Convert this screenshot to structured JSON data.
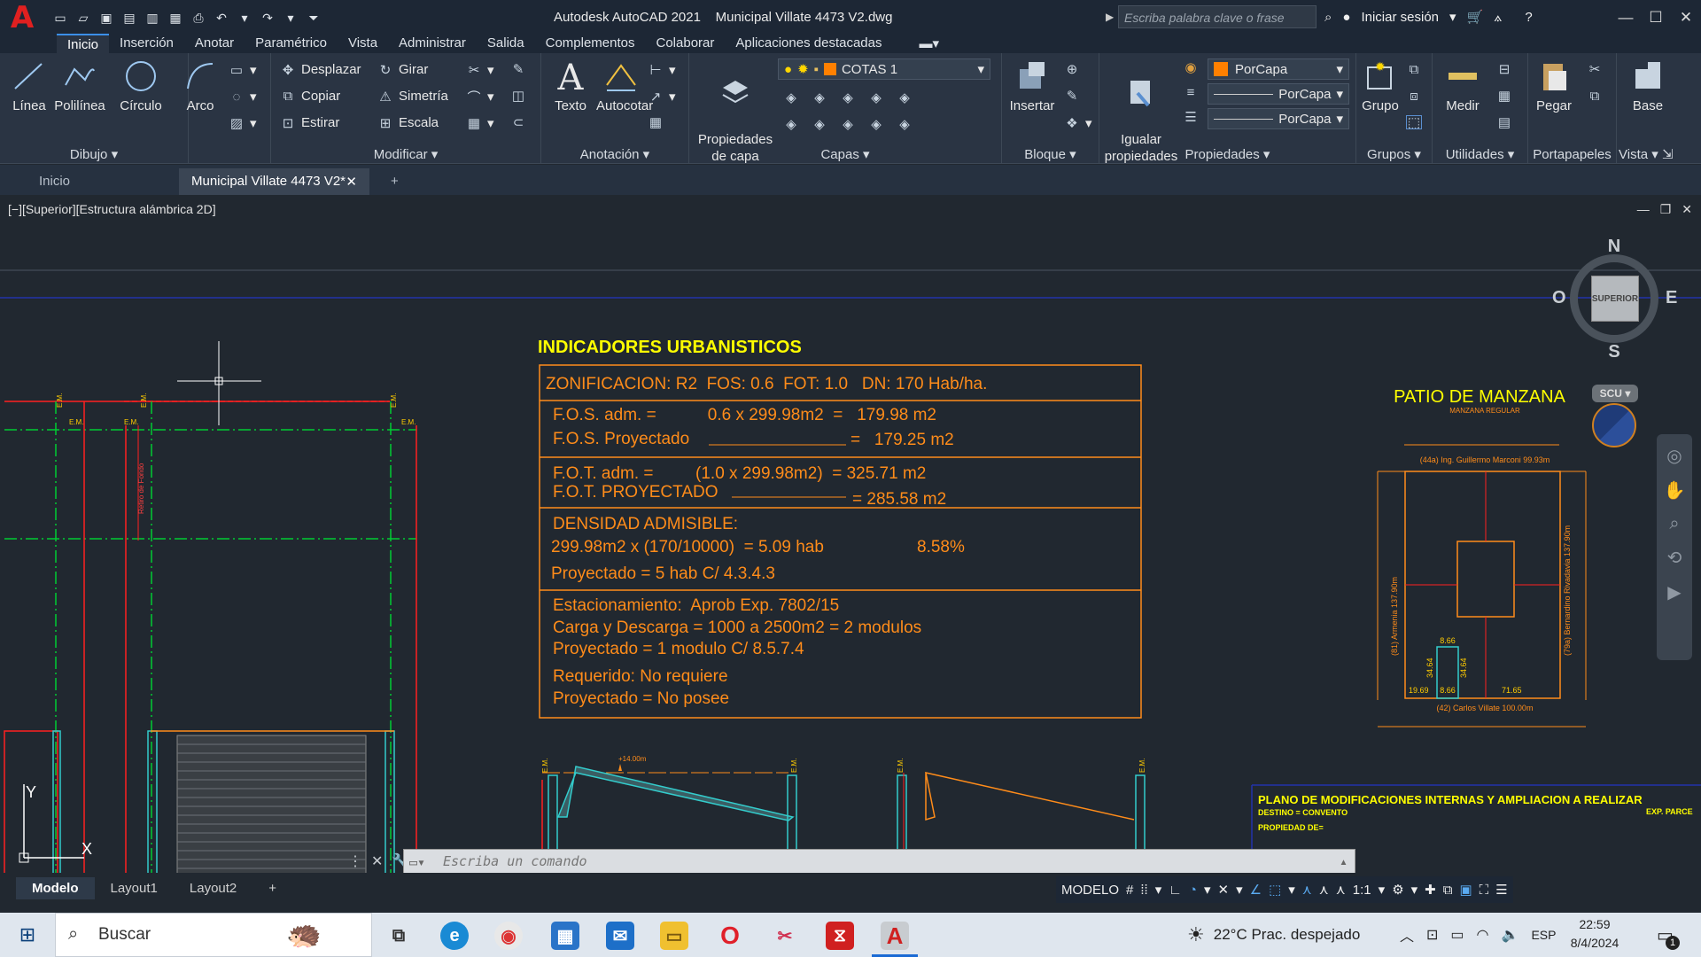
{
  "app": {
    "title": "Autodesk AutoCAD 2021    Municipal Villate 4473 V2.dwg",
    "search_placeholder": "Escriba palabra clave o frase",
    "signin": "Iniciar sesión"
  },
  "ribbon_tabs": [
    "Inicio",
    "Inserción",
    "Anotar",
    "Paramétrico",
    "Vista",
    "Administrar",
    "Salida",
    "Complementos",
    "Colaborar",
    "Aplicaciones destacadas"
  ],
  "ribbon": {
    "dibujo": {
      "title": "Dibujo",
      "linea": "Línea",
      "polilinea": "Polilínea",
      "circulo": "Círculo",
      "arco": "Arco"
    },
    "modificar": {
      "title": "Modificar",
      "desplazar": "Desplazar",
      "girar": "Girar",
      "copiar": "Copiar",
      "simetria": "Simetría",
      "estirar": "Estirar",
      "escala": "Escala"
    },
    "anotacion": {
      "title": "Anotación",
      "texto": "Texto",
      "autocotar": "Autocotar"
    },
    "capas": {
      "title": "Capas",
      "propiedades": "Propiedades\nde capa",
      "layer_value": "COTAS 1"
    },
    "bloque": {
      "title": "Bloque",
      "insertar": "Insertar"
    },
    "propiedades": {
      "title": "Propiedades",
      "igualar": "Igualar\npropiedades",
      "color": "PorCapa",
      "linetype": "PorCapa",
      "lineweight": "PorCapa"
    },
    "grupos": {
      "title": "Grupos",
      "grupo": "Grupo"
    },
    "utilidades": {
      "title": "Utilidades",
      "medir": "Medir"
    },
    "portapapeles": {
      "title": "Portapapeles",
      "pegar": "Pegar"
    },
    "vista": {
      "title": "Vista",
      "base": "Base"
    }
  },
  "doc_tabs": {
    "inicio": "Inicio",
    "active": "Municipal Villate 4473 V2*"
  },
  "viewport_label": "[−][Superior][Estructura alámbrica 2D]",
  "viewcube": {
    "n": "N",
    "s": "S",
    "e": "E",
    "o": "O",
    "face": "SUPERIOR",
    "ucs": "SCU"
  },
  "drawing": {
    "title": "INDICADORES URBANISTICOS",
    "row1": "ZONIFICACION: R2  FOS: 0.6  FOT: 1.0   DN: 170 Hab/ha.",
    "fos_adm": "F.O.S. adm. =           0.6 x 299.98m2  =   179.98 m2",
    "fos_proy": "F.O.S. Proyectado",
    "fos_proy_val": "=   179.25 m2",
    "fot_adm": "F.O.T. adm. =         (1.0 x 299.98m2)  = 325.71 m2",
    "fot_proy": "F.O.T. PROYECTADO",
    "fot_proy_val": "= 285.58 m2",
    "dens_title": "DENSIDAD ADMISIBLE:",
    "dens_calc": "299.98m2 x (170/10000)  = 5.09 hab",
    "dens_pct": "8.58%",
    "dens_proy": "Proyectado = 5 hab C/ 4.3.4.3",
    "est1": "Estacionamiento:  Aprob Exp. 7802/15",
    "est2": "Carga y Descarga = 1000 a 2500m2 = 2 modulos",
    "est3": "Proyectado = 1 modulo C/ 8.5.7.4",
    "est4": "Requerido: No requiere",
    "est5": "Proyectado = No posee",
    "patio_title": "PATIO DE MANZANA",
    "patio_sub": "MANZANA REGULAR",
    "patio_top": "(44a) Ing. Guillermo Marconi  99.93m",
    "patio_bottom": "(42) Carlos Villate 100.00m",
    "patio_left": "(81) Armenia 137.90m",
    "patio_right": "(79a) Bernardino Rivadavia 137.90m",
    "dim_866a": "8.66",
    "dim_866b": "8.66",
    "dim_3464a": "34.64",
    "dim_3464b": "34.64",
    "dim_1969": "19.69",
    "dim_7165": "71.65",
    "em": "E.M.",
    "retiro": "Retiro de Fondo",
    "level": "+14.00m",
    "plano_title": "PLANO DE MODIFICACIONES INTERNAS Y AMPLIACION A REALIZAR",
    "plano_destino": "DESTINO = CONVENTO",
    "plano_prop": "PROPIEDAD DE=",
    "plano_exp": "EXP. PARCE"
  },
  "command_placeholder": "Escriba un comando",
  "layout_tabs": [
    "Modelo",
    "Layout1",
    "Layout2"
  ],
  "status": {
    "modelo": "MODELO",
    "scale": "1:1"
  },
  "taskbar": {
    "search": "Buscar",
    "weather": "22°C  Prac. despejado",
    "lang": "ESP",
    "time": "22:59",
    "date": "8/4/2024",
    "notif_count": "1"
  },
  "colors": {
    "ribbon_bg": "#2a3443",
    "canvas_bg": "#212830",
    "drawing_orange": "#ff8c1a",
    "drawing_yellow": "#ffff00",
    "drawing_red": "#ff2020",
    "drawing_green": "#00cc33",
    "drawing_cyan": "#33cccc"
  }
}
